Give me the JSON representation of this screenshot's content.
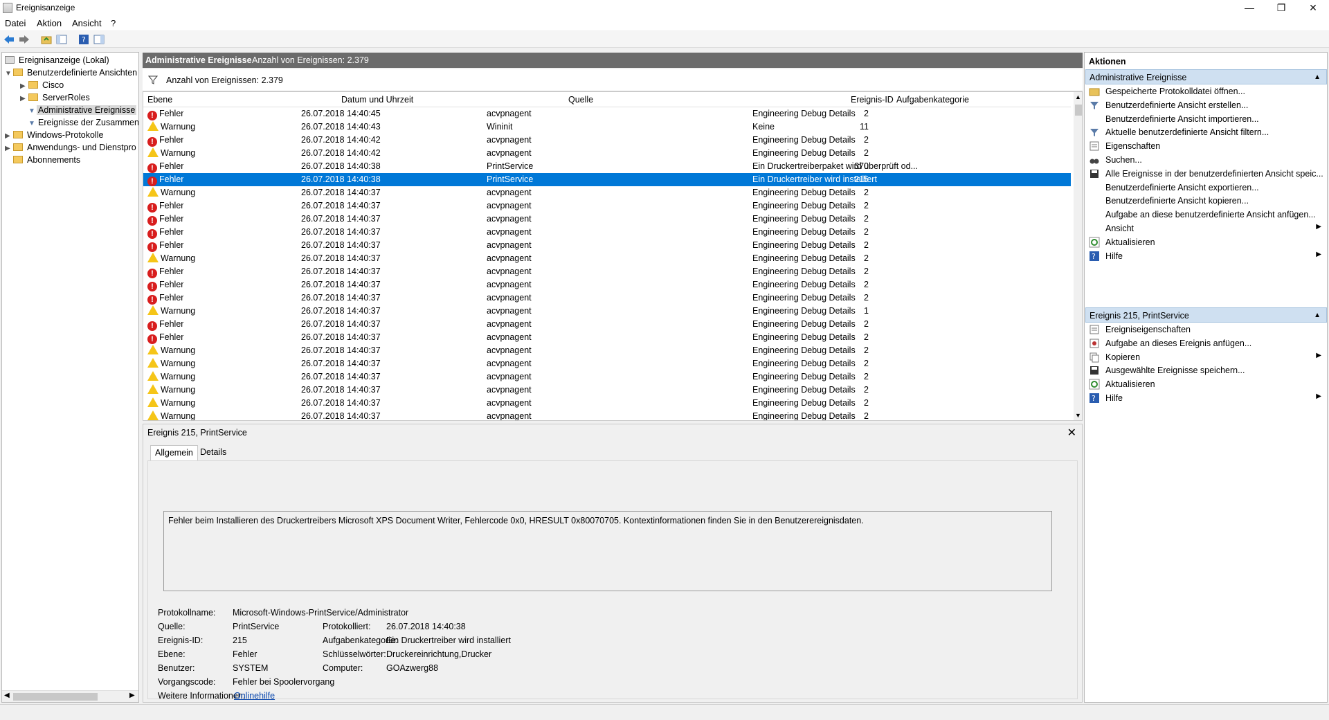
{
  "window": {
    "title": "Ereignisanzeige"
  },
  "menu": [
    "Datei",
    "Aktion",
    "Ansicht",
    "?"
  ],
  "tree": {
    "items": [
      {
        "label": "Ereignisanzeige (Lokal)",
        "level": 0
      },
      {
        "label": "Benutzerdefinierte Ansichten",
        "level": 1,
        "expanded": true
      },
      {
        "label": "Cisco",
        "level": 2
      },
      {
        "label": "ServerRoles",
        "level": 2
      },
      {
        "label": "Administrative Ereignisse",
        "level": 2,
        "selected": true
      },
      {
        "label": "Ereignisse der Zusammen",
        "level": 2
      },
      {
        "label": "Windows-Protokolle",
        "level": 1
      },
      {
        "label": "Anwendungs- und Dienstpro",
        "level": 1
      },
      {
        "label": "Abonnements",
        "level": 1
      }
    ]
  },
  "center": {
    "header_title": "Administrative Ereignisse",
    "header_count": "Anzahl von Ereignissen: 2.379",
    "filter_text": "Anzahl von Ereignissen: 2.379"
  },
  "grid": {
    "columns": [
      "Ebene",
      "Datum und Uhrzeit",
      "Quelle",
      "Ereignis-ID",
      "Aufgabenkategorie"
    ],
    "rows": [
      [
        "Fehler",
        "26.07.2018 14:40:45",
        "acvpnagent",
        "2",
        "Engineering Debug Details"
      ],
      [
        "Warnung",
        "26.07.2018 14:40:43",
        "Wininit",
        "11",
        "Keine"
      ],
      [
        "Fehler",
        "26.07.2018 14:40:42",
        "acvpnagent",
        "2",
        "Engineering Debug Details"
      ],
      [
        "Warnung",
        "26.07.2018 14:40:42",
        "acvpnagent",
        "2",
        "Engineering Debug Details"
      ],
      [
        "Fehler",
        "26.07.2018 14:40:38",
        "PrintService",
        "370",
        "Ein Druckertreiberpaket wird überprüft od..."
      ],
      [
        "Fehler",
        "26.07.2018 14:40:38",
        "PrintService",
        "215",
        "Ein Druckertreiber wird installiert"
      ],
      [
        "Warnung",
        "26.07.2018 14:40:37",
        "acvpnagent",
        "2",
        "Engineering Debug Details"
      ],
      [
        "Fehler",
        "26.07.2018 14:40:37",
        "acvpnagent",
        "2",
        "Engineering Debug Details"
      ],
      [
        "Fehler",
        "26.07.2018 14:40:37",
        "acvpnagent",
        "2",
        "Engineering Debug Details"
      ],
      [
        "Fehler",
        "26.07.2018 14:40:37",
        "acvpnagent",
        "2",
        "Engineering Debug Details"
      ],
      [
        "Fehler",
        "26.07.2018 14:40:37",
        "acvpnagent",
        "2",
        "Engineering Debug Details"
      ],
      [
        "Warnung",
        "26.07.2018 14:40:37",
        "acvpnagent",
        "2",
        "Engineering Debug Details"
      ],
      [
        "Fehler",
        "26.07.2018 14:40:37",
        "acvpnagent",
        "2",
        "Engineering Debug Details"
      ],
      [
        "Fehler",
        "26.07.2018 14:40:37",
        "acvpnagent",
        "2",
        "Engineering Debug Details"
      ],
      [
        "Fehler",
        "26.07.2018 14:40:37",
        "acvpnagent",
        "2",
        "Engineering Debug Details"
      ],
      [
        "Warnung",
        "26.07.2018 14:40:37",
        "acvpnagent",
        "1",
        "Engineering Debug Details"
      ],
      [
        "Fehler",
        "26.07.2018 14:40:37",
        "acvpnagent",
        "2",
        "Engineering Debug Details"
      ],
      [
        "Fehler",
        "26.07.2018 14:40:37",
        "acvpnagent",
        "2",
        "Engineering Debug Details"
      ],
      [
        "Warnung",
        "26.07.2018 14:40:37",
        "acvpnagent",
        "2",
        "Engineering Debug Details"
      ],
      [
        "Warnung",
        "26.07.2018 14:40:37",
        "acvpnagent",
        "2",
        "Engineering Debug Details"
      ],
      [
        "Warnung",
        "26.07.2018 14:40:37",
        "acvpnagent",
        "2",
        "Engineering Debug Details"
      ],
      [
        "Warnung",
        "26.07.2018 14:40:37",
        "acvpnagent",
        "2",
        "Engineering Debug Details"
      ],
      [
        "Warnung",
        "26.07.2018 14:40:37",
        "acvpnagent",
        "2",
        "Engineering Debug Details"
      ],
      [
        "Warnung",
        "26.07.2018 14:40:37",
        "acvpnagent",
        "2",
        "Engineering Debug Details"
      ]
    ],
    "selected_row": 5
  },
  "detail": {
    "title": "Ereignis 215, PrintService",
    "tabs": [
      "Allgemein",
      "Details"
    ],
    "message": "Fehler beim Installieren des Druckertreibers Microsoft XPS Document Writer, Fehlercode 0x0, HRESULT 0x80070705. Kontextinformationen finden Sie in den Benutzerereignisdaten.",
    "fields": {
      "protokollname_label": "Protokollname:",
      "protokollname": "Microsoft-Windows-PrintService/Administrator",
      "quelle_label": "Quelle:",
      "quelle": "PrintService",
      "protokolliert_label": "Protokolliert:",
      "protokolliert": "26.07.2018 14:40:38",
      "ereignis_id_label": "Ereignis-ID:",
      "ereignis_id": "215",
      "aufgabenkategorie_label": "Aufgabenkategorie:",
      "aufgabenkategorie": "Ein Druckertreiber wird installiert",
      "ebene_label": "Ebene:",
      "ebene": "Fehler",
      "schluesselwoerter_label": "Schlüsselwörter:",
      "schluesselwoerter": "Druckereinrichtung,Drucker",
      "benutzer_label": "Benutzer:",
      "benutzer": "SYSTEM",
      "computer_label": "Computer:",
      "computer": "GOAzwerg88",
      "vorgangscode_label": "Vorgangscode:",
      "vorgangscode": "Fehler bei Spoolervorgang",
      "weitere_label": "Weitere Informationen:",
      "weitere_link": "Onlinehilfe"
    }
  },
  "actions": {
    "title": "Aktionen",
    "section1": "Administrative Ereignisse",
    "items1": [
      {
        "label": "Gespeicherte Protokolldatei öffnen...",
        "icon": "open-folder-icon"
      },
      {
        "label": "Benutzerdefinierte Ansicht erstellen...",
        "icon": "filter-icon"
      },
      {
        "label": "Benutzerdefinierte Ansicht importieren...",
        "icon": ""
      },
      {
        "label": "Aktuelle benutzerdefinierte Ansicht filtern...",
        "icon": "filter-icon"
      },
      {
        "label": "Eigenschaften",
        "icon": "properties-icon"
      },
      {
        "label": "Suchen...",
        "icon": "binoculars-icon"
      },
      {
        "label": "Alle Ereignisse in der benutzerdefinierten Ansicht speic...",
        "icon": "save-icon"
      },
      {
        "label": "Benutzerdefinierte Ansicht exportieren...",
        "icon": ""
      },
      {
        "label": "Benutzerdefinierte Ansicht kopieren...",
        "icon": ""
      },
      {
        "label": "Aufgabe an diese benutzerdefinierte Ansicht anfügen...",
        "icon": ""
      },
      {
        "label": "Ansicht",
        "icon": "",
        "submenu": true
      },
      {
        "label": "Aktualisieren",
        "icon": "refresh-icon"
      },
      {
        "label": "Hilfe",
        "icon": "help-icon",
        "submenu": true
      }
    ],
    "section2": "Ereignis 215, PrintService",
    "items2": [
      {
        "label": "Ereigniseigenschaften",
        "icon": "properties-icon"
      },
      {
        "label": "Aufgabe an dieses Ereignis anfügen...",
        "icon": "task-icon"
      },
      {
        "label": "Kopieren",
        "icon": "copy-icon",
        "submenu": true
      },
      {
        "label": "Ausgewählte Ereignisse speichern...",
        "icon": "save-icon"
      },
      {
        "label": "Aktualisieren",
        "icon": "refresh-icon"
      },
      {
        "label": "Hilfe",
        "icon": "help-icon",
        "submenu": true
      }
    ]
  },
  "colors": {
    "selection": "#0078d7",
    "section_header": "#cfe0f1",
    "center_header": "#6b6b6b",
    "error": "#d81e1e",
    "warning": "#f5c518"
  }
}
